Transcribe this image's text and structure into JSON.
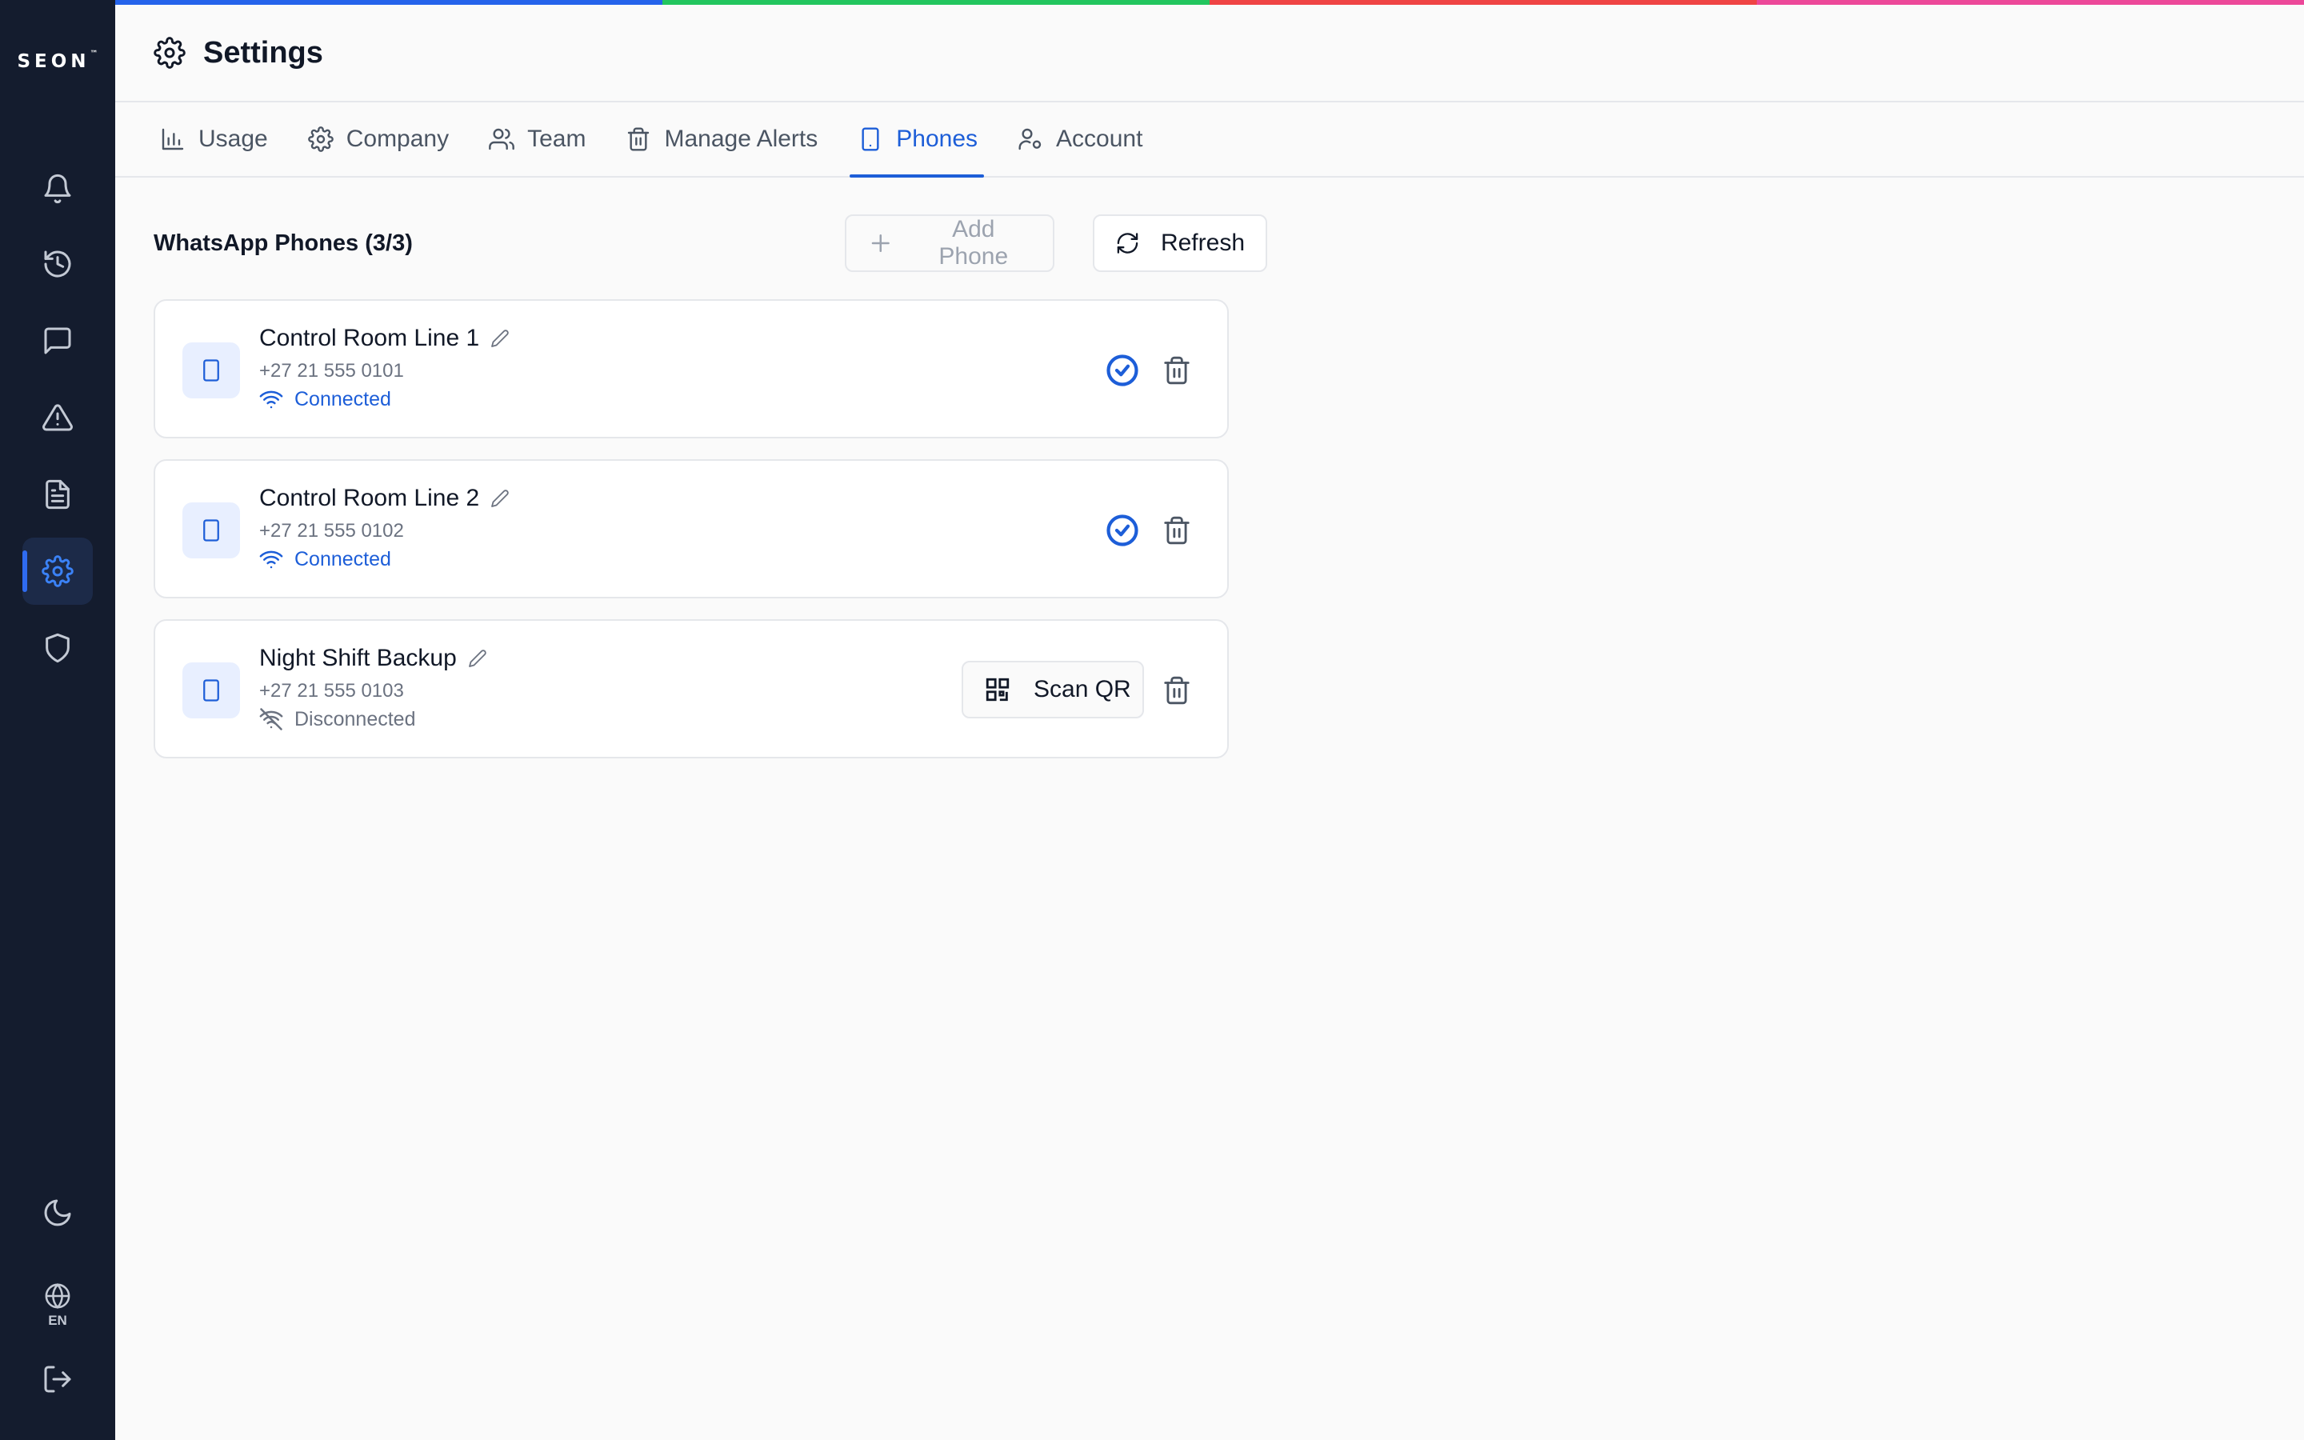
{
  "brand": {
    "logo_text": "SEON",
    "logo_mark": "™",
    "stripe_colors": [
      "#2563eb",
      "#22c55e",
      "#ef4444",
      "#ec4899"
    ]
  },
  "sidebar": {
    "items": [
      {
        "icon": "bell-icon",
        "active": false
      },
      {
        "icon": "history-icon",
        "active": false
      },
      {
        "icon": "message-icon",
        "active": false
      },
      {
        "icon": "alert-triangle-icon",
        "active": false
      },
      {
        "icon": "document-icon",
        "active": false
      },
      {
        "icon": "gear-icon",
        "active": true
      },
      {
        "icon": "shield-icon",
        "active": false
      }
    ],
    "footer": {
      "theme_icon": "moon-icon",
      "language_label": "EN",
      "logout_icon": "logout-icon"
    }
  },
  "header": {
    "title": "Settings",
    "icon": "gear-icon"
  },
  "tabs": [
    {
      "label": "Usage",
      "icon": "bar-chart-icon",
      "active": false
    },
    {
      "label": "Company",
      "icon": "gear-icon",
      "active": false
    },
    {
      "label": "Team",
      "icon": "users-icon",
      "active": false
    },
    {
      "label": "Manage Alerts",
      "icon": "trash-icon",
      "active": false
    },
    {
      "label": "Phones",
      "icon": "smartphone-icon",
      "active": true
    },
    {
      "label": "Account",
      "icon": "user-cog-icon",
      "active": false
    }
  ],
  "phones_section": {
    "title": "WhatsApp Phones (3/3)",
    "add_label": "Add Phone",
    "refresh_label": "Refresh"
  },
  "phones": [
    {
      "name": "Control Room Line 1",
      "number": "+27 21 555 0101",
      "status": "Connected",
      "connected": true
    },
    {
      "name": "Control Room Line 2",
      "number": "+27 21 555 0102",
      "status": "Connected",
      "connected": true
    },
    {
      "name": "Night Shift Backup",
      "number": "+27 21 555 0103",
      "status": "Disconnected",
      "connected": false,
      "action_label": "Scan QR"
    }
  ],
  "colors": {
    "accent": "#1d5ed8",
    "sidebar_bg": "#141c2e"
  }
}
